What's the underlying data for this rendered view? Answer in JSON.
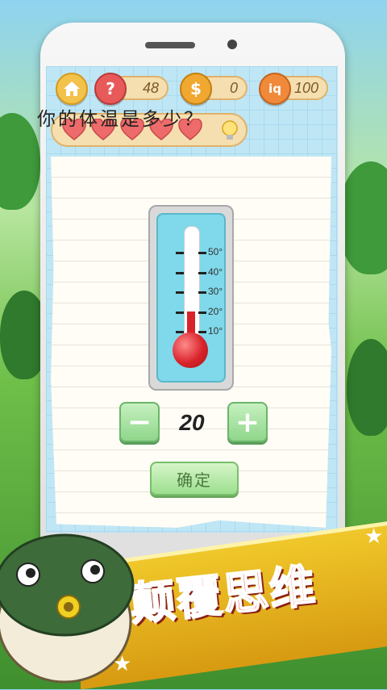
{
  "topbar": {
    "home_icon": "home-icon",
    "hint_count": "48",
    "coins": "0",
    "iq": "100"
  },
  "lives": {
    "hearts": 5,
    "hint_icon": "lightbulb-icon"
  },
  "question": "你的体温是多少？",
  "thermometer": {
    "scale_labels": [
      "50°",
      "40°",
      "30°",
      "20°",
      "10°"
    ],
    "reading": 20
  },
  "controls": {
    "minus_label": "−",
    "plus_label": "+",
    "value": "20",
    "confirm_label": "确定"
  },
  "banner": {
    "text": "颠覆思维"
  },
  "colors": {
    "accent": "#e43b2a",
    "panel": "#f5dfb0",
    "button_green": "#8fd68a",
    "mercury": "#d9232b"
  }
}
